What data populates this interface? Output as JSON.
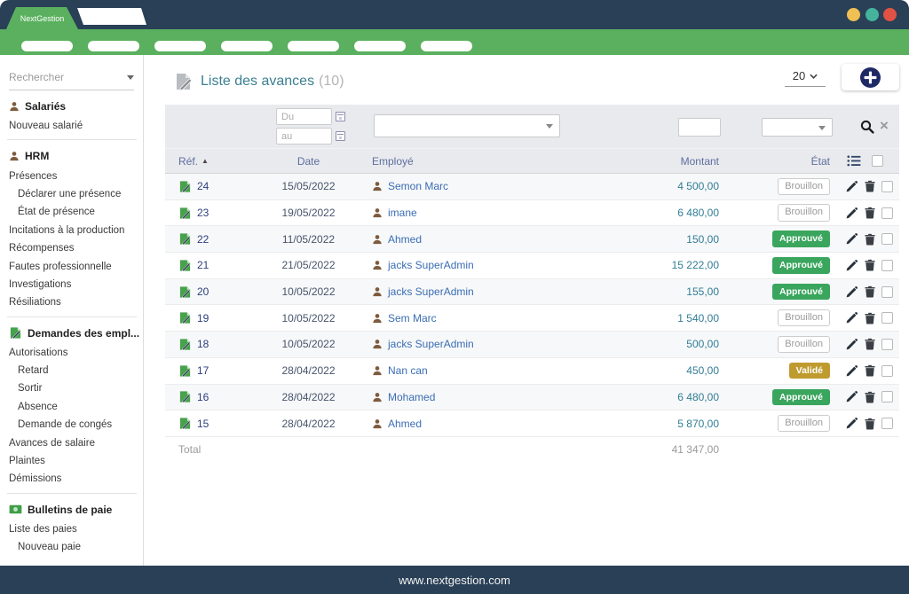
{
  "titlebar": {
    "brand": "NextGestion"
  },
  "window_controls": {
    "colors": {
      "minimize": "#f0c054",
      "maximize": "#45b39c",
      "close": "#e05243"
    }
  },
  "navbar": {
    "pill_count": 7,
    "color": "#5ab05e"
  },
  "sidebar": {
    "search_placeholder": "Rechercher",
    "groups": [
      {
        "icon": "user",
        "title": "Salariés",
        "items": [
          {
            "label": "Nouveau salarié",
            "indent": 0
          }
        ]
      },
      {
        "icon": "user",
        "title": "HRM",
        "items": [
          {
            "label": "Présences",
            "indent": 0
          },
          {
            "label": "Déclarer une présence",
            "indent": 1
          },
          {
            "label": "État de présence",
            "indent": 1
          },
          {
            "label": "Incitations à la production",
            "indent": 0
          },
          {
            "label": "Récompenses",
            "indent": 0
          },
          {
            "label": "Fautes professionnelle",
            "indent": 0
          },
          {
            "label": "Investigations",
            "indent": 0
          },
          {
            "label": "Résiliations",
            "indent": 0
          }
        ]
      },
      {
        "icon": "doc",
        "title": "Demandes des empl...",
        "items": [
          {
            "label": "Autorisations",
            "indent": 0
          },
          {
            "label": "Retard",
            "indent": 1
          },
          {
            "label": "Sortir",
            "indent": 1
          },
          {
            "label": "Absence",
            "indent": 1
          },
          {
            "label": "Demande de congés",
            "indent": 1
          },
          {
            "label": "Avances de salaire",
            "indent": 0
          },
          {
            "label": "Plaintes",
            "indent": 0
          },
          {
            "label": "Démissions",
            "indent": 0
          }
        ]
      },
      {
        "icon": "money",
        "title": "Bulletins de paie",
        "items": [
          {
            "label": "Liste des paies",
            "indent": 0
          },
          {
            "label": "Nouveau paie",
            "indent": 1
          }
        ]
      }
    ]
  },
  "header": {
    "title": "Liste des avances",
    "count": "(10)",
    "page_size": "20"
  },
  "filters": {
    "date_from_placeholder": "Du",
    "date_to_placeholder": "au"
  },
  "table": {
    "columns": {
      "ref": "Réf.",
      "date": "Date",
      "employee": "Employé",
      "amount": "Montant",
      "status": "État"
    },
    "rows": [
      {
        "ref": "24",
        "date": "15/05/2022",
        "employee": "Semon Marc",
        "amount": "4 500,00",
        "status": "Brouillon",
        "status_type": "draft"
      },
      {
        "ref": "23",
        "date": "19/05/2022",
        "employee": "imane",
        "amount": "6 480,00",
        "status": "Brouillon",
        "status_type": "draft"
      },
      {
        "ref": "22",
        "date": "11/05/2022",
        "employee": "Ahmed",
        "amount": "150,00",
        "status": "Approuvé",
        "status_type": "approved"
      },
      {
        "ref": "21",
        "date": "21/05/2022",
        "employee": "jacks SuperAdmin",
        "amount": "15 222,00",
        "status": "Approuvé",
        "status_type": "approved"
      },
      {
        "ref": "20",
        "date": "10/05/2022",
        "employee": "jacks SuperAdmin",
        "amount": "155,00",
        "status": "Approuvé",
        "status_type": "approved"
      },
      {
        "ref": "19",
        "date": "10/05/2022",
        "employee": "Sem Marc",
        "amount": "1 540,00",
        "status": "Brouillon",
        "status_type": "draft"
      },
      {
        "ref": "18",
        "date": "10/05/2022",
        "employee": "jacks SuperAdmin",
        "amount": "500,00",
        "status": "Brouillon",
        "status_type": "draft"
      },
      {
        "ref": "17",
        "date": "28/04/2022",
        "employee": "Nan can",
        "amount": "450,00",
        "status": "Validé",
        "status_type": "validated"
      },
      {
        "ref": "16",
        "date": "28/04/2022",
        "employee": "Mohamed",
        "amount": "6 480,00",
        "status": "Approuvé",
        "status_type": "approved"
      },
      {
        "ref": "15",
        "date": "28/04/2022",
        "employee": "Ahmed",
        "amount": "5 870,00",
        "status": "Brouillon",
        "status_type": "draft"
      }
    ],
    "total_label": "Total",
    "total_value": "41 347,00"
  },
  "status_colors": {
    "approved": "#3aa55d",
    "validated": "#bf9b2f",
    "draft_border": "#cccccc"
  },
  "footer": {
    "url": "www.nextgestion.com"
  },
  "icons": {
    "search": "magnifier",
    "clear": "×",
    "calendar": "small-square",
    "sort": "▲",
    "user": "person-silhouette",
    "doc": "document-with-pencil",
    "money": "banknote",
    "edit": "pencil",
    "delete": "trash-can",
    "add": "plus-in-circle",
    "list": "list-bullets"
  }
}
